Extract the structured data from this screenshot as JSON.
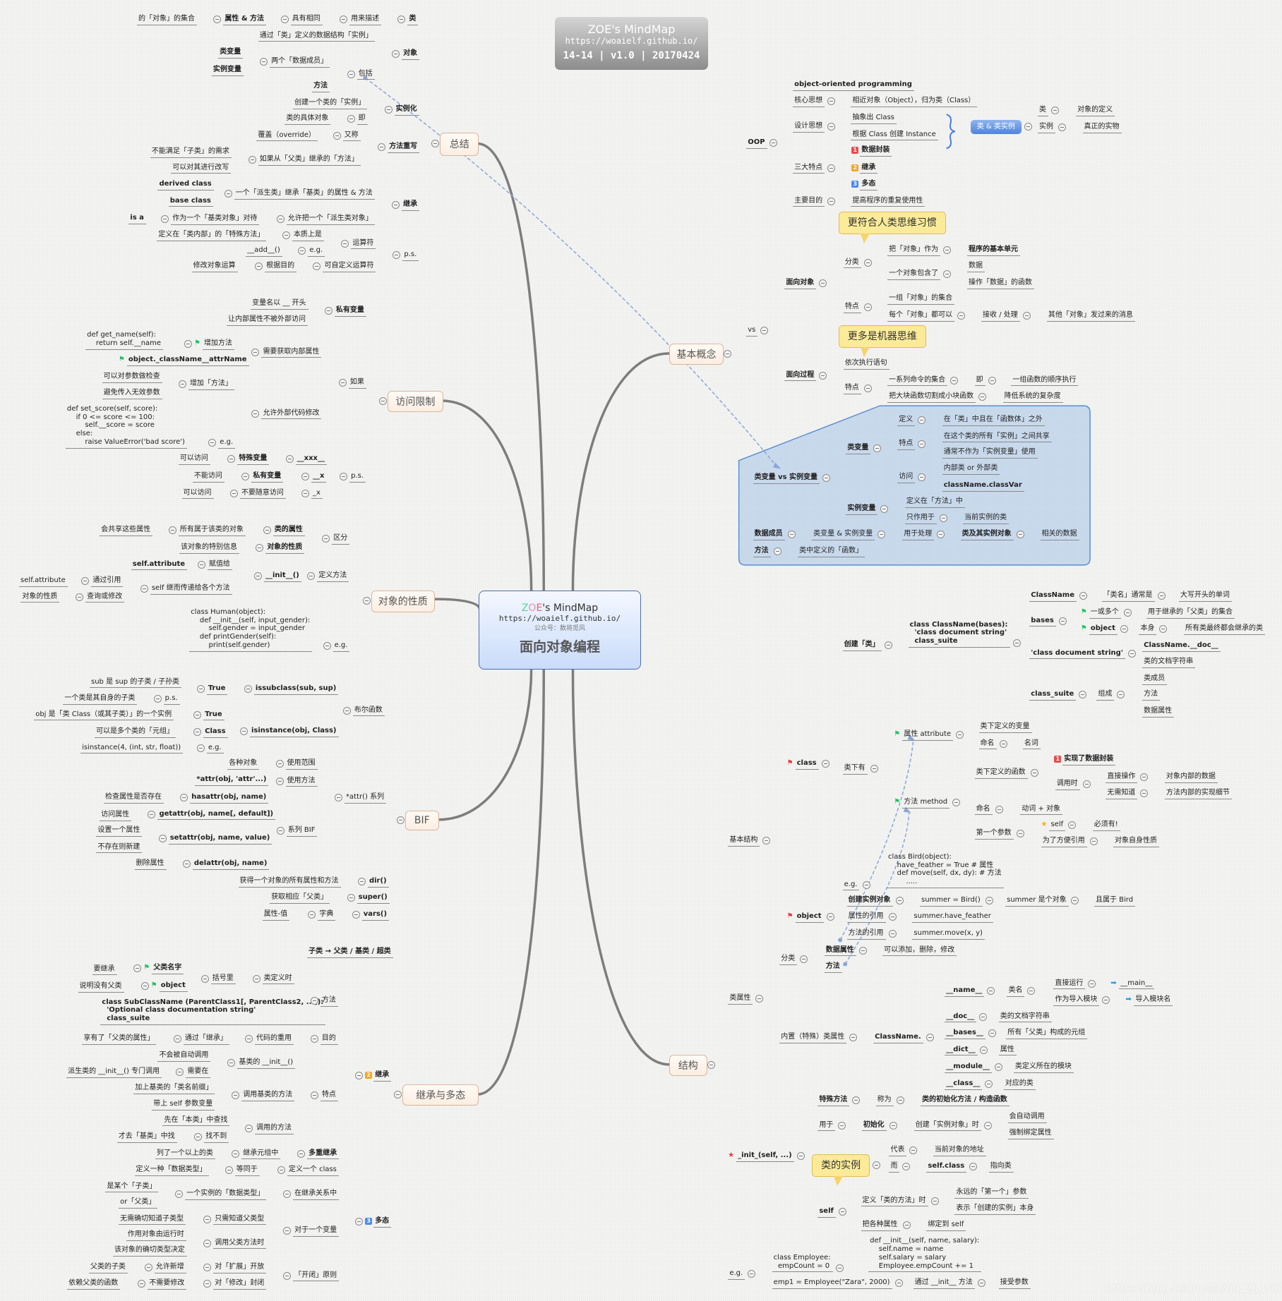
{
  "header_card": {
    "title": "ZOE's MindMap",
    "url": "https://woaielf.github.io/",
    "meta": "14-14 | v1.0 | 20170424"
  },
  "center": {
    "brand_prefix": "ZOE",
    "brand_suffix": "'s MindMap",
    "url": "https://woaielf.github.io/",
    "wechat": "公众号：数将觅风",
    "title": "面向对象编程"
  },
  "colors": {
    "brand_z": "#5fd38a",
    "brand_o": "#f08cb0",
    "brand_e": "#f06060",
    "topic_border": "#d9b79b",
    "center_border": "#4d6fa8",
    "callout": "#fbeb98",
    "region": "#b9d0ea",
    "badge1": "#e94b4b",
    "badge2": "#f5a623",
    "badge3": "#4a8af4",
    "flag_green": "#22c55e",
    "flag_red": "#e53e3e"
  },
  "watermark": "https://blog.csdn.net/qq_21165007",
  "branches": [
    {
      "topic": "总结",
      "nodes": [
        "的「对象」的集合",
        "属性 & 方法",
        "具有相同",
        "用来描述",
        "类",
        "通过「类」定义的数据结构「实例」",
        "对象",
        "类变量",
        "两个「数据成员」",
        "实例变量",
        "包括",
        "方法",
        "创建一个类的「实例」",
        "实例化",
        "类的具体对象",
        "即",
        "覆盖（override）",
        "又称",
        "方法重写",
        "不能满足「子类」的需求",
        "如果从「父类」继承的「方法」",
        "可以对其进行改写",
        "derived class",
        "一个「派生类」继承「基类」的属性 & 方法",
        "base class",
        "继承",
        "is a",
        "作为一个「基类对象」对待",
        "允许把一个「派生类对象」",
        "定义在「类内部」的「特殊方法」",
        "本质上是",
        "运算符",
        "__add__()",
        "e.g.",
        "p.s.",
        "修改对象运算",
        "根据目的",
        "可自定义运算符"
      ]
    },
    {
      "topic": "访问限制",
      "nodes": [
        "变量名以 __ 开头",
        "私有变量",
        "让内部属性不被外部访问",
        "def get_name(self):\n    return self.__name",
        "增加方法",
        "需要获取内部属性",
        "object._className__attrName",
        "如果",
        "可以对参数做检查",
        "增加「方法」",
        "避免传入无效参数",
        "def set_score(self, score):\n    if 0 <= score <= 100:\n        self.__score = score\n    else:\n        raise ValueError('bad score')",
        "e.g.",
        "允许外部代码修改",
        "可以访问",
        "特殊变量",
        "__xxx__",
        "不能访问",
        "私有变量",
        "__x",
        "p.s.",
        "可以访问",
        "不要随意访问",
        "_x"
      ]
    },
    {
      "topic": "对象的性质",
      "nodes": [
        "会共享这些属性",
        "所有属于该类的对象",
        "类的属性",
        "区分",
        "该对象的特别信息",
        "对象的性质",
        "self.attribute",
        "赋值给",
        "__init__()",
        "定义方法",
        "self.attribute",
        "通过引用",
        "self 继而传递给各个方法",
        "对象的性质",
        "查询或修改",
        "class Human(object):\n    def __init__(self, input_gender):\n        self.gender = input_gender\n    def printGender(self):\n        print(self.gender)",
        "e.g."
      ]
    },
    {
      "topic": "BIF",
      "nodes": [
        "sub 是 sup 的子类 / 子孙类",
        "True",
        "issubclass(sub, sup)",
        "一个类是其自身的子类",
        "p.s.",
        "布尔函数",
        "obj 是「类 Class（或其子类）」的一个实例",
        "True",
        "可以是多个类的「元组」",
        "Class",
        "isinstance(obj, Class)",
        "isinstance(4, (int, str, float))",
        "e.g.",
        "各种对象",
        "使用范围",
        "*attr(obj, 'attr'...)",
        "使用方法",
        "*attr() 系列",
        "检查属性是否存在",
        "hasattr(obj, name)",
        "访问属性",
        "getattr(obj, name[, default])",
        "系列 BIF",
        "设置一个属性",
        "setattr(obj, name, value)",
        "不存在则新建",
        "删除属性",
        "delattr(obj, name)",
        "获得一个对象的所有属性和方法",
        "dir()",
        "获取相应「父类」",
        "super()",
        "属性-值",
        "字典",
        "vars()"
      ]
    },
    {
      "topic": "继承与多态",
      "nodes": [
        "子类 → 父类 / 基类 / 超类",
        "要继承",
        "父类名字",
        "括号里",
        "类定义时",
        "说明没有父类",
        "object",
        "方法",
        "class SubClassName (ParentClass1[, ParentClass2, ...]):\n  'Optional class documentation string'\n  class_suite",
        "享有了「父类的属性」",
        "通过「继承」",
        "代码的重用",
        "目的",
        "不会被自动调用",
        "基类的 __init__()",
        "派生类的 __init__() 专门调用",
        "需要在",
        "加上基类的「类名前缀」",
        "调用基类的方法",
        "特点",
        "带上 self 参数变量",
        "先在「本类」中查找",
        "调用的方法",
        "才去「基类」中找",
        "找不到",
        "列了一个以上的类",
        "继承元组中",
        "多重继承",
        "继承",
        "定义一种「数据类型」",
        "等同于",
        "定义一个 class",
        "是某个「子类」",
        "一个实例的「数据类型」",
        "在继承关系中",
        "or「父类」",
        "无需确切知道子类型",
        "只需知道父类型",
        "对于一个变量",
        "作用对象由运行时",
        "调用父类方法时",
        "该对象的确切类型决定",
        "父类的子类",
        "允许新增",
        "对「扩展」开放",
        "「开闭」原则",
        "依赖父类的函数",
        "不需要修改",
        "对「修改」封闭",
        "多态"
      ]
    },
    {
      "topic": "基本概念",
      "nodes": [
        "object-oriented programming",
        "OOP",
        "核心思想",
        "相近对象（Object），归为类（Class）",
        "设计思想",
        "抽象出 Class",
        "根据 Class 创建 Instance",
        "类 & 类实例",
        "类",
        "对象的定义",
        "实例",
        "真正的实物",
        "三大特点",
        "数据封装",
        "继承",
        "多态",
        "主要目的",
        "提高程序的重复使用性",
        "更符合人类思维习惯",
        "vs",
        "面向对象",
        "分类",
        "把「对象」作为",
        "程序的基本单元",
        "一个对象包含了",
        "数据",
        "操作「数据」的函数",
        "特点",
        "一组「对象」的集合",
        "每个「对象」都可以",
        "接收 / 处理",
        "其他「对象」发过来的消息",
        "更多是机器思维",
        "面向过程",
        "依次执行语句",
        "特点",
        "一系列命令的集合",
        "即",
        "一组函数的顺序执行",
        "把大块函数切割成小块函数",
        "降低系统的复杂度",
        "类变量 vs 实例变量",
        "类变量",
        "定义",
        "在「类」中且在「函数体」之外",
        "特点",
        "在这个类的所有「实例」之间共享",
        "通常不作为「实例变量」使用",
        "访问",
        "内部类 or 外部类",
        "className.classVar",
        "实例变量",
        "定义在「方法」中",
        "只作用于",
        "当前实例的类",
        "数据成员",
        "类变量 & 实例变量",
        "用于处理",
        "类及其实例对象",
        "相关的数据",
        "方法",
        "类中定义的「函数」"
      ]
    },
    {
      "topic": "结构",
      "nodes": [
        "基本结构",
        "创建「类」",
        "class ClassName(bases):\n  'class document string'\n  class_suite",
        "ClassName",
        "「类名」通常是",
        "大写开头的单词",
        "bases",
        "一或多个",
        "用于继承的「父类」的集合",
        "object",
        "本身",
        "所有类最终都会继承的类",
        "'class document string'",
        "ClassName.__doc__",
        "类的文档字符串",
        "class_suite",
        "组成",
        "类成员",
        "方法",
        "数据属性",
        "class",
        "类下有",
        "属性 attribute",
        "类下定义的变量",
        "命名",
        "名词",
        "实现了数据封装",
        "类下定义的函数",
        "调用时",
        "直接操作",
        "对象内部的数据",
        "无需知道",
        "方法内部的实现细节",
        "方法 method",
        "命名",
        "动词 + 对象",
        "self",
        "必须有!",
        "第一个参数",
        "为了方便引用",
        "对象自身性质",
        "class Bird(object):\n    have_feather = True # 属性\n    def move(self, dx, dy): # 方法\n        .....",
        "e.g.",
        "object",
        "创建实例对象",
        "summer = Bird()",
        "summer 是个对象",
        "且属于 Bird",
        "属性的引用",
        "summer.have_feather",
        "方法的引用",
        "summer.move(x, y)",
        "类属性",
        "分类",
        "数据属性",
        "可以添加，删除，修改",
        "方法",
        "内置（特殊）类属性",
        "ClassName.",
        "__name__",
        "类名",
        "直接运行",
        "__main__",
        "作为导入模块",
        "导入模块名",
        "__doc__",
        "类的文档字符串",
        "__bases__",
        "所有「父类」构成的元组",
        "__dict__",
        "属性",
        "__module__",
        "类定义所在的模块",
        "__class__",
        "对应的类",
        "_init_(self, ...)",
        "特殊方法",
        "称为",
        "类的初始化方法 / 构造函数",
        "用于",
        "初始化",
        "创建「实例对象」时",
        "会自动调用",
        "强制绑定属性",
        "类的实例",
        "代表",
        "当前对象的地址",
        "而",
        "self.class",
        "指向类",
        "self",
        "定义「类的方法」时",
        "永远的「第一个」参数",
        "表示「创建的实例」本身",
        "把各种属性",
        "绑定到 self",
        "e.g.",
        "class Employee:\n  empCount = 0",
        "def __init__(self, name, salary):\n    self.name = name\n    self.salary = salary\n    Employee.empCount += 1",
        "emp1 = Employee(\"Zara\", 2000)",
        "通过 __init__ 方法",
        "接受参数"
      ]
    }
  ]
}
